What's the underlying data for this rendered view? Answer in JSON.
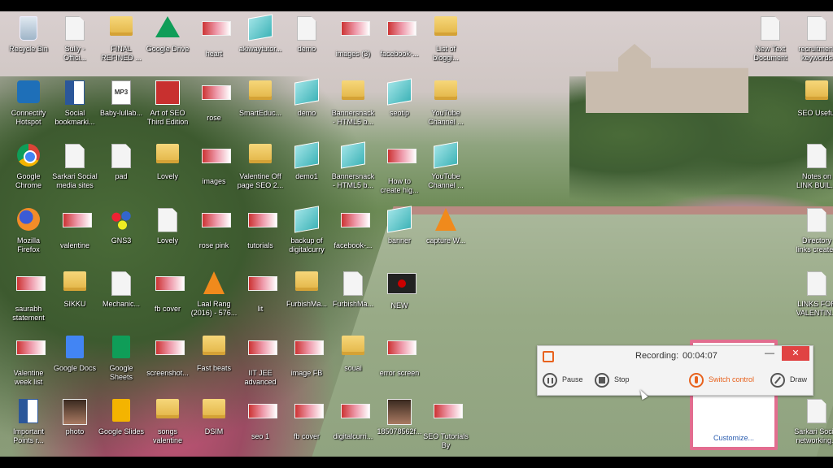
{
  "colors": {
    "accent": "#e8621d",
    "close": "#e04343",
    "customize_border": "#e26d8f"
  },
  "desktop_icons": [
    {
      "label": "Recycle Bin",
      "icon": "recycle-bin-icon",
      "col": 0,
      "row": 0
    },
    {
      "label": "Connectify\nHotspot",
      "icon": "wifi-icon",
      "col": 0,
      "row": 1
    },
    {
      "label": "Google\nChrome",
      "icon": "chrome-icon",
      "col": 0,
      "row": 2
    },
    {
      "label": "Mozilla\nFirefox",
      "icon": "firefox-icon",
      "col": 0,
      "row": 3
    },
    {
      "label": "saurabh\nstatement",
      "icon": "thumb-icon",
      "col": 0,
      "row": 4
    },
    {
      "label": "Valentine\nweek list",
      "icon": "thumb-icon",
      "col": 0,
      "row": 5
    },
    {
      "label": "Important\nPoints r...",
      "icon": "word-icon",
      "col": 0,
      "row": 6
    },
    {
      "label": "Sully -\nOffici...",
      "icon": "doc-icon",
      "col": 1,
      "row": 0
    },
    {
      "label": "Social\nbookmarki...",
      "icon": "word-icon",
      "col": 1,
      "row": 1
    },
    {
      "label": "Sarkari Social\nmedia sites",
      "icon": "doc-icon",
      "col": 1,
      "row": 2
    },
    {
      "label": "valentine",
      "icon": "thumb-icon",
      "col": 1,
      "row": 3
    },
    {
      "label": "SIKKU",
      "icon": "folder-icon",
      "col": 1,
      "row": 4
    },
    {
      "label": "Google Docs",
      "icon": "google-docs-icon",
      "col": 1,
      "row": 5
    },
    {
      "label": "photo",
      "icon": "photo-icon",
      "col": 1,
      "row": 6
    },
    {
      "label": "FINAL\nREFINED ...",
      "icon": "folder-icon",
      "col": 2,
      "row": 0
    },
    {
      "label": "Baby-lullab...",
      "icon": "mp3-icon",
      "col": 2,
      "row": 1
    },
    {
      "label": "pad",
      "icon": "doc-icon",
      "col": 2,
      "row": 2
    },
    {
      "label": "GNS3",
      "icon": "gns3-icon",
      "col": 2,
      "row": 3
    },
    {
      "label": "Mechanic...",
      "icon": "doc-icon",
      "col": 2,
      "row": 4
    },
    {
      "label": "Google\nSheets",
      "icon": "google-sheets-icon",
      "col": 2,
      "row": 5
    },
    {
      "label": "Google Slides",
      "icon": "google-slides-icon",
      "col": 2,
      "row": 6
    },
    {
      "label": "Google Drive",
      "icon": "google-drive-icon",
      "col": 3,
      "row": 0
    },
    {
      "label": "Art of SEO\nThird Edition",
      "icon": "seo-book-icon",
      "col": 3,
      "row": 1
    },
    {
      "label": "Lovely",
      "icon": "folder-icon",
      "col": 3,
      "row": 2
    },
    {
      "label": "Lovely",
      "icon": "doc-icon",
      "col": 3,
      "row": 3
    },
    {
      "label": "fb cover",
      "icon": "thumb-icon",
      "col": 3,
      "row": 4
    },
    {
      "label": "screenshot...",
      "icon": "thumb-icon",
      "col": 3,
      "row": 5
    },
    {
      "label": "songs\nvalentine",
      "icon": "folder-icon",
      "col": 3,
      "row": 6
    },
    {
      "label": "heart",
      "icon": "thumb-icon",
      "col": 4,
      "row": 0
    },
    {
      "label": "rose",
      "icon": "thumb-icon",
      "col": 4,
      "row": 1
    },
    {
      "label": "images",
      "icon": "thumb-icon",
      "col": 4,
      "row": 2
    },
    {
      "label": "rose pink",
      "icon": "thumb-icon",
      "col": 4,
      "row": 3
    },
    {
      "label": "Laal Rang\n(2016) - 576...",
      "icon": "vlc-icon",
      "col": 4,
      "row": 4
    },
    {
      "label": "Fast beats",
      "icon": "folder-icon",
      "col": 4,
      "row": 5
    },
    {
      "label": "DSIM",
      "icon": "folder-icon",
      "col": 4,
      "row": 6
    },
    {
      "label": "akiwaytutor...",
      "icon": "publisher-icon",
      "col": 5,
      "row": 0
    },
    {
      "label": "SmartEduc...",
      "icon": "folder-icon",
      "col": 5,
      "row": 1
    },
    {
      "label": "Valentine Off\npage SEO 2...",
      "icon": "folder-icon",
      "col": 5,
      "row": 2
    },
    {
      "label": "tutorials",
      "icon": "thumb-icon",
      "col": 5,
      "row": 3
    },
    {
      "label": "lit",
      "icon": "thumb-icon",
      "col": 5,
      "row": 4
    },
    {
      "label": "IIT JEE\nadvanced",
      "icon": "thumb-icon",
      "col": 5,
      "row": 5
    },
    {
      "label": "seo 1",
      "icon": "thumb-icon",
      "col": 5,
      "row": 6
    },
    {
      "label": "demo",
      "icon": "doc-icon",
      "col": 6,
      "row": 0
    },
    {
      "label": "demo",
      "icon": "publisher-icon",
      "col": 6,
      "row": 1
    },
    {
      "label": "demo1",
      "icon": "publisher-icon",
      "col": 6,
      "row": 2
    },
    {
      "label": "backup of\ndigitalcurry",
      "icon": "publisher-icon",
      "col": 6,
      "row": 3
    },
    {
      "label": "FurbishMa...",
      "icon": "folder-icon",
      "col": 6,
      "row": 4
    },
    {
      "label": "image FB",
      "icon": "thumb-icon",
      "col": 6,
      "row": 5
    },
    {
      "label": "fb cover",
      "icon": "thumb-icon",
      "col": 6,
      "row": 6
    },
    {
      "label": "images (3)",
      "icon": "thumb-icon",
      "col": 7,
      "row": 0
    },
    {
      "label": "Bannersnack\n- HTML5 b...",
      "icon": "folder-icon",
      "col": 7,
      "row": 1
    },
    {
      "label": "Bannersnack\n- HTML5 b...",
      "icon": "publisher-icon",
      "col": 7,
      "row": 2
    },
    {
      "label": "facebook-...",
      "icon": "thumb-icon",
      "col": 7,
      "row": 3
    },
    {
      "label": "FurbishMa...",
      "icon": "doc-icon",
      "col": 7,
      "row": 4
    },
    {
      "label": "souai",
      "icon": "folder-icon",
      "col": 7,
      "row": 5
    },
    {
      "label": "digitalcurri...",
      "icon": "thumb-icon",
      "col": 7,
      "row": 6
    },
    {
      "label": "facebook-...",
      "icon": "thumb-icon",
      "col": 8,
      "row": 0
    },
    {
      "label": "seotip",
      "icon": "publisher-icon",
      "col": 8,
      "row": 1
    },
    {
      "label": "How to\ncreate hig...",
      "icon": "thumb-icon",
      "col": 8,
      "row": 2
    },
    {
      "label": "banner",
      "icon": "publisher-icon",
      "col": 8,
      "row": 3
    },
    {
      "label": "NEW",
      "icon": "recorder-icon",
      "col": 8,
      "row": 4
    },
    {
      "label": "error screen",
      "icon": "thumb-icon",
      "col": 8,
      "row": 5
    },
    {
      "label": "185078562f...",
      "icon": "photo-icon",
      "col": 8,
      "row": 6
    },
    {
      "label": "List of\nbloggi...",
      "icon": "folder-icon",
      "col": 9,
      "row": 0
    },
    {
      "label": "YouTube\nChannel ...",
      "icon": "folder-icon",
      "col": 9,
      "row": 1
    },
    {
      "label": "YouTube\nChannel ...",
      "icon": "publisher-icon",
      "col": 9,
      "row": 2
    },
    {
      "label": "capture W...",
      "icon": "vlc-icon",
      "col": 9,
      "row": 3
    },
    {
      "label": "SEO Tutorials\nBy",
      "icon": "thumb-icon",
      "col": 9,
      "row": 6
    },
    {
      "label": "New Text\nDocument",
      "icon": "doc-icon",
      "col": 16,
      "row": 0
    },
    {
      "label": "recruitment\nkeywords",
      "icon": "doc-icon",
      "col": 17,
      "row": 0
    },
    {
      "label": "SEO Useful",
      "icon": "folder-icon",
      "col": 17,
      "row": 1
    },
    {
      "label": "Notes on\nLINK BUIL...",
      "icon": "doc-icon",
      "col": 17,
      "row": 2
    },
    {
      "label": "Directory\nlinks created",
      "icon": "doc-icon",
      "col": 17,
      "row": 3
    },
    {
      "label": "LINKS FOR\nVALENTIN...",
      "icon": "doc-icon",
      "col": 17,
      "row": 4
    },
    {
      "label": "Sarkari Social\nnetworking...",
      "icon": "doc-icon",
      "col": 17,
      "row": 6
    }
  ],
  "recorder": {
    "status_label": "Recording:",
    "elapsed": "00:04:07",
    "minimize": "—",
    "close": "✕",
    "pause": "Pause",
    "stop": "Stop",
    "switch_control": "Switch control",
    "draw": "Draw"
  },
  "customize_panel": {
    "button": "Customize..."
  }
}
